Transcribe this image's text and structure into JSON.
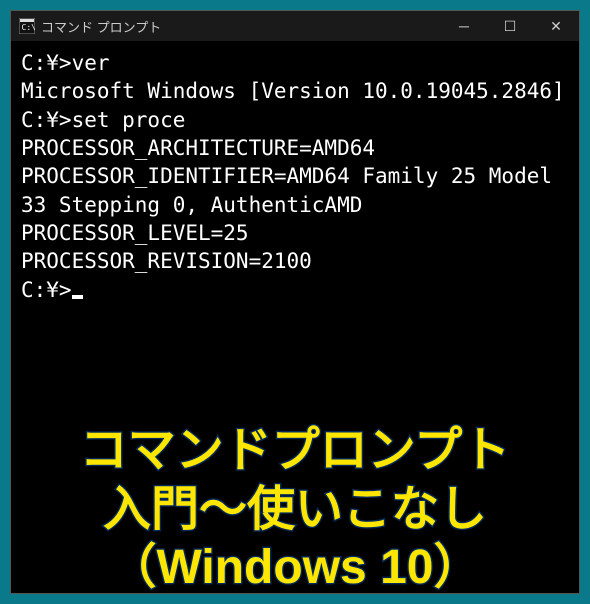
{
  "titlebar": {
    "title": "コマンド プロンプト",
    "minimize_symbol": "─",
    "maximize_symbol": "☐",
    "close_symbol": "✕"
  },
  "terminal": {
    "lines": [
      "",
      "C:\\>ver",
      "",
      "Microsoft Windows [Version 10.0.19045.2846]",
      "",
      "C:\\>set proce",
      "PROCESSOR_ARCHITECTURE=AMD64",
      "PROCESSOR_IDENTIFIER=AMD64 Family 25 Model 33 Stepping 0, AuthenticAMD",
      "PROCESSOR_LEVEL=25",
      "PROCESSOR_REVISION=2100",
      "",
      "C:\\>"
    ],
    "show_cursor_on_last": true
  },
  "overlay": {
    "line1": "コマンドプロンプト",
    "line2": "入門～使いこなし",
    "line3": "（Windows 10）"
  }
}
